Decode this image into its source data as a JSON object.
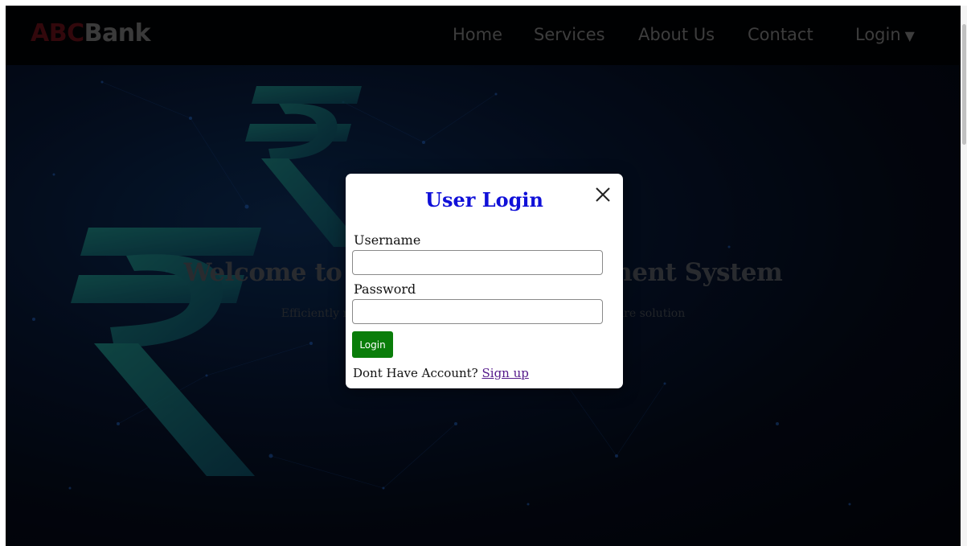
{
  "brand": {
    "part1": "ABC",
    "part2": "Bank",
    "color_part1": "#5c0f17"
  },
  "nav": {
    "home": "Home",
    "services": "Services",
    "about": "About Us",
    "contact": "Contact",
    "login": "Login",
    "login_caret_icon": "chevron-down-icon"
  },
  "hero": {
    "title": "Welcome to ABC Bank Management System",
    "subtitle": "Efficiently manage your banking operations with our software solution"
  },
  "modal": {
    "title": "User Login",
    "close_icon": "close-icon",
    "username_label": "Username",
    "username_value": "",
    "password_label": "Password",
    "password_value": "",
    "login_button": "Login",
    "signup_prompt": "Dont Have Account?",
    "signup_link": "Sign up"
  },
  "colors": {
    "modal_title": "#1010d8",
    "login_button": "#0a7d0a",
    "signup_link": "#551a8b"
  }
}
